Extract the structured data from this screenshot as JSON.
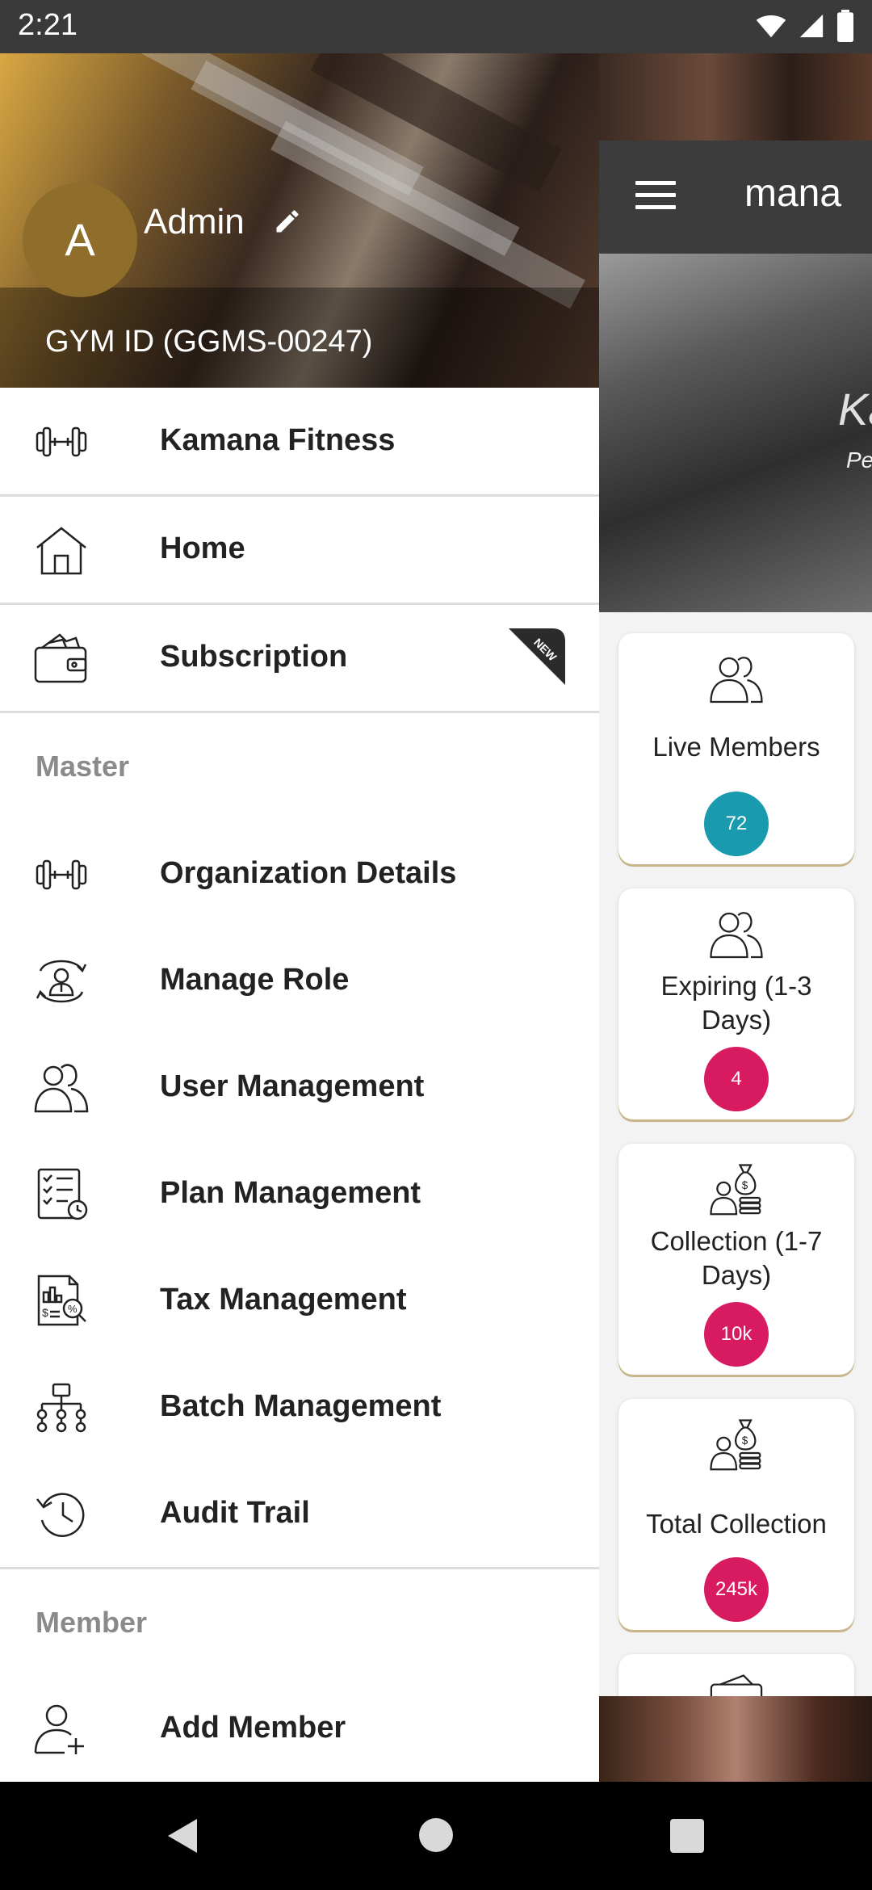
{
  "status_bar": {
    "time": "2:21"
  },
  "background_app": {
    "title": "mana",
    "banner_title": "Ka",
    "banner_sub": "Pe",
    "cards": [
      {
        "label": "Live Members",
        "value": "72",
        "badge_color": "#1a9aae"
      },
      {
        "label": "Expiring (1-3 Days)",
        "value": "4",
        "badge_color": "#d81b60"
      },
      {
        "label": "Collection (1-7 Days)",
        "value": "10k",
        "badge_color": "#d81b60"
      },
      {
        "label": "Total Collection",
        "value": "245k",
        "badge_color": "#d81b60"
      }
    ]
  },
  "drawer": {
    "avatar_letter": "A",
    "user_name": "Admin",
    "gym_id": "GYM ID (GGMS-00247)",
    "top_items": [
      {
        "label": "Kamana Fitness",
        "icon": "dumbbell-icon"
      },
      {
        "label": "Home",
        "icon": "home-icon"
      },
      {
        "label": "Subscription",
        "icon": "wallet-icon",
        "badge": "NEW"
      }
    ],
    "master_title": "Master",
    "master_items": [
      {
        "label": "Organization Details",
        "icon": "dumbbell-icon"
      },
      {
        "label": "Manage Role",
        "icon": "role-icon"
      },
      {
        "label": "User Management",
        "icon": "users-icon"
      },
      {
        "label": "Plan Management",
        "icon": "checklist-icon"
      },
      {
        "label": "Tax Management",
        "icon": "tax-icon"
      },
      {
        "label": "Batch Management",
        "icon": "hierarchy-icon"
      },
      {
        "label": "Audit Trail",
        "icon": "history-icon"
      }
    ],
    "member_title": "Member",
    "member_items": [
      {
        "label": "Add Member",
        "icon": "add-user-icon"
      }
    ]
  },
  "colors": {
    "accent_gold": "#8e6e2a",
    "teal": "#1a9aae",
    "pink": "#d81b60"
  }
}
